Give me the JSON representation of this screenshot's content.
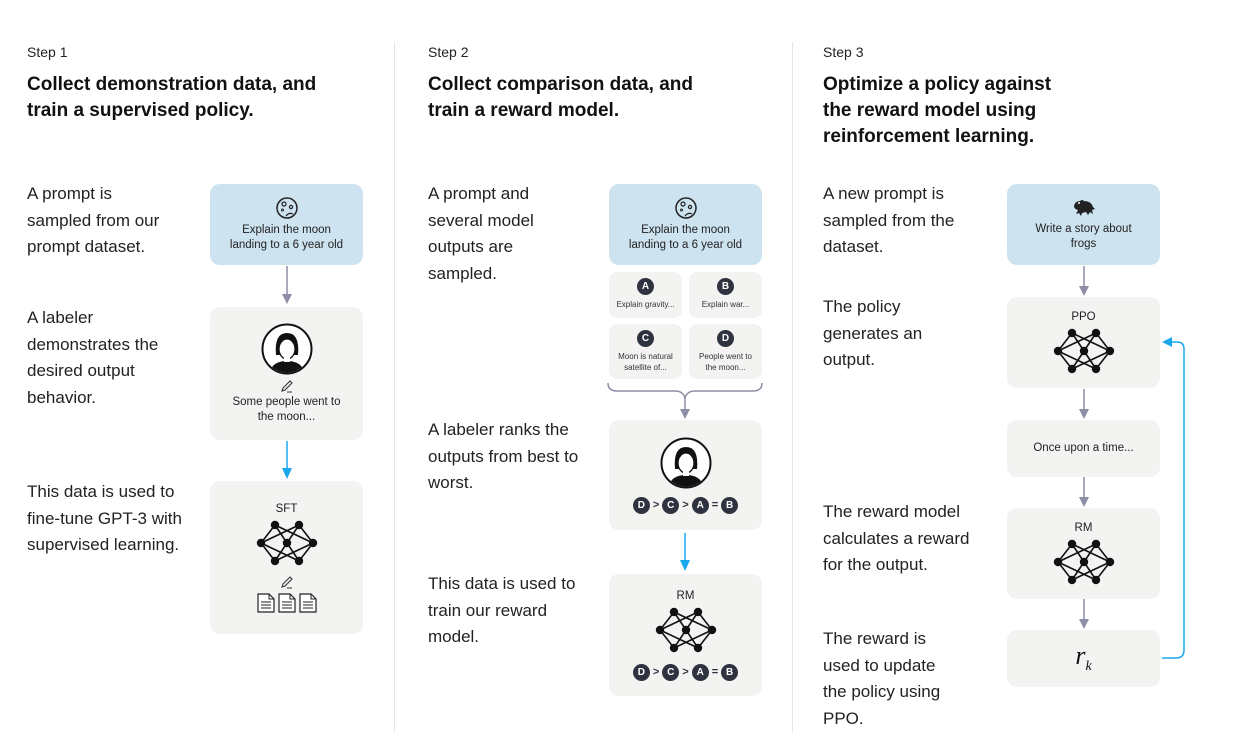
{
  "colors": {
    "prompt_box": "#cde3f0",
    "neutral_box": "#f3f3f2",
    "gray_arrow": "#8e8ea6",
    "blue_arrow": "#1aa7ec",
    "badge": "#2f3340"
  },
  "steps": [
    {
      "label": "Step 1",
      "title": "Collect demonstration data, and train a supervised policy.",
      "descriptions": [
        "A prompt is sampled from our prompt dataset.",
        "A labeler demonstrates the desired output behavior.",
        "This data is used to fine-tune GPT-3 with supervised learning."
      ],
      "prompt_icon": "moon-icon",
      "prompt_text": "Explain the moon landing to a 6 year old",
      "labeler_icon": "labeler-avatar-icon",
      "demo_text": "Some people went to the moon...",
      "model_label": "SFT",
      "model_icon": "neural-network-icon",
      "extra_icons": [
        "pencil-icon",
        "document-icon",
        "document-icon",
        "document-icon"
      ]
    },
    {
      "label": "Step 2",
      "title": "Collect comparison data, and train a reward model.",
      "descriptions": [
        "A prompt and several model outputs are sampled.",
        "A labeler ranks the outputs from best to worst.",
        "This data is used to train our reward model."
      ],
      "prompt_icon": "moon-icon",
      "prompt_text": "Explain the moon landing to a 6 year old",
      "outputs": [
        {
          "letter": "A",
          "text": "Explain gravity..."
        },
        {
          "letter": "B",
          "text": "Explain war..."
        },
        {
          "letter": "C",
          "text": "Moon is natural satellite of..."
        },
        {
          "letter": "D",
          "text": "People went to the moon..."
        }
      ],
      "ranking": [
        {
          "type": "badge",
          "value": "D"
        },
        {
          "type": "op",
          "value": ">"
        },
        {
          "type": "badge",
          "value": "C"
        },
        {
          "type": "op",
          "value": ">"
        },
        {
          "type": "badge",
          "value": "A"
        },
        {
          "type": "op",
          "value": "="
        },
        {
          "type": "badge",
          "value": "B"
        }
      ],
      "model_label": "RM",
      "model_icon": "neural-network-icon"
    },
    {
      "label": "Step 3",
      "title": "Optimize a policy against the reward model using reinforcement learning.",
      "descriptions": [
        "A new prompt is sampled from the dataset.",
        "The policy generates an output.",
        "The reward model calculates a reward for the output.",
        "The reward is used to update the policy using PPO."
      ],
      "prompt_icon": "frog-icon",
      "prompt_text": "Write a story about frogs",
      "policy_label": "PPO",
      "output_text": "Once upon a time...",
      "model_label": "RM",
      "reward_symbol": "r",
      "reward_subscript": "k"
    }
  ]
}
